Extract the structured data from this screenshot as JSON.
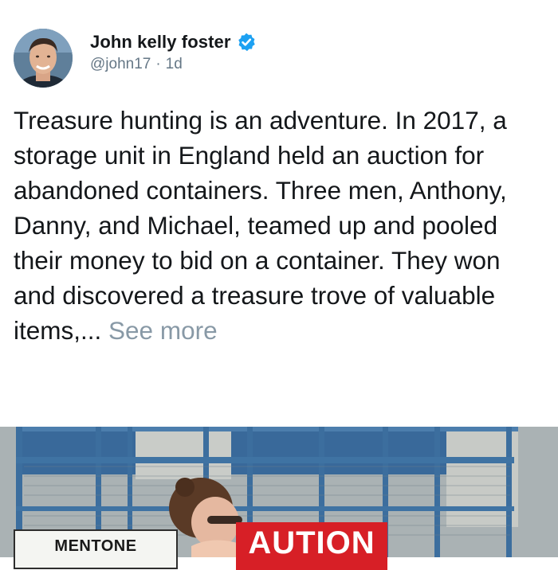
{
  "tweet": {
    "author": {
      "display_name": "John kelly foster",
      "handle": "@john17",
      "separator": "·",
      "timestamp": "1d",
      "verified_icon": "verified-badge-icon",
      "verified_color": "#1da1f2"
    },
    "text": "Treasure hunting is an adventure. In 2017, a storage unit in England held an auction for abandoned containers. Three men, Anthony, Danny, and Michael, teamed up and pooled their money to bid on a container. They won and discovered a treasure trove of valuable items,...",
    "see_more_label": "See more",
    "media": {
      "sign_left_text": "MENTONE",
      "sign_right_text": "AUTION"
    }
  }
}
